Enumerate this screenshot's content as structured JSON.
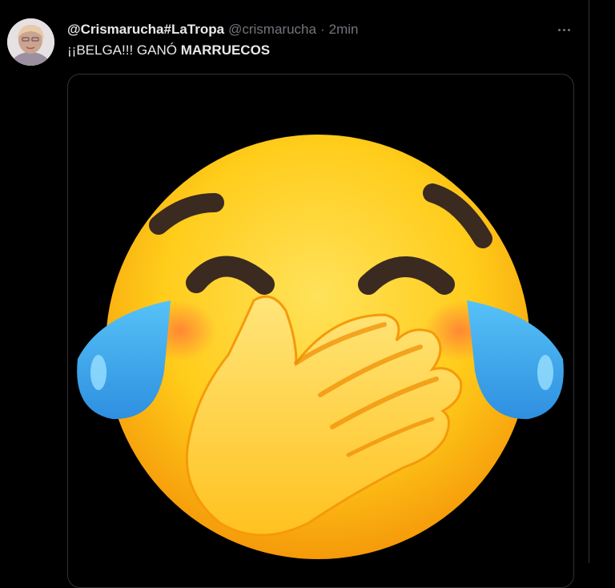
{
  "tweet": {
    "display_name": "@Crismarucha#LaTropa",
    "handle": "@crismarucha",
    "separator": "·",
    "time": "2min",
    "text_plain": "¡¡BELGA!!! GANÓ ",
    "text_bold": "MARRUECOS",
    "media_icon": "face-with-hand-over-mouth-and-tears-emoji"
  },
  "icons": {
    "more": "more-horizontal-icon",
    "avatar": "user-avatar"
  },
  "colors": {
    "background": "#000000",
    "border": "#2f3336",
    "text_primary": "#e7e9ea",
    "text_secondary": "#71767b",
    "emoji_face": "#FFCC1A",
    "emoji_tear": "#4FB3F0"
  }
}
